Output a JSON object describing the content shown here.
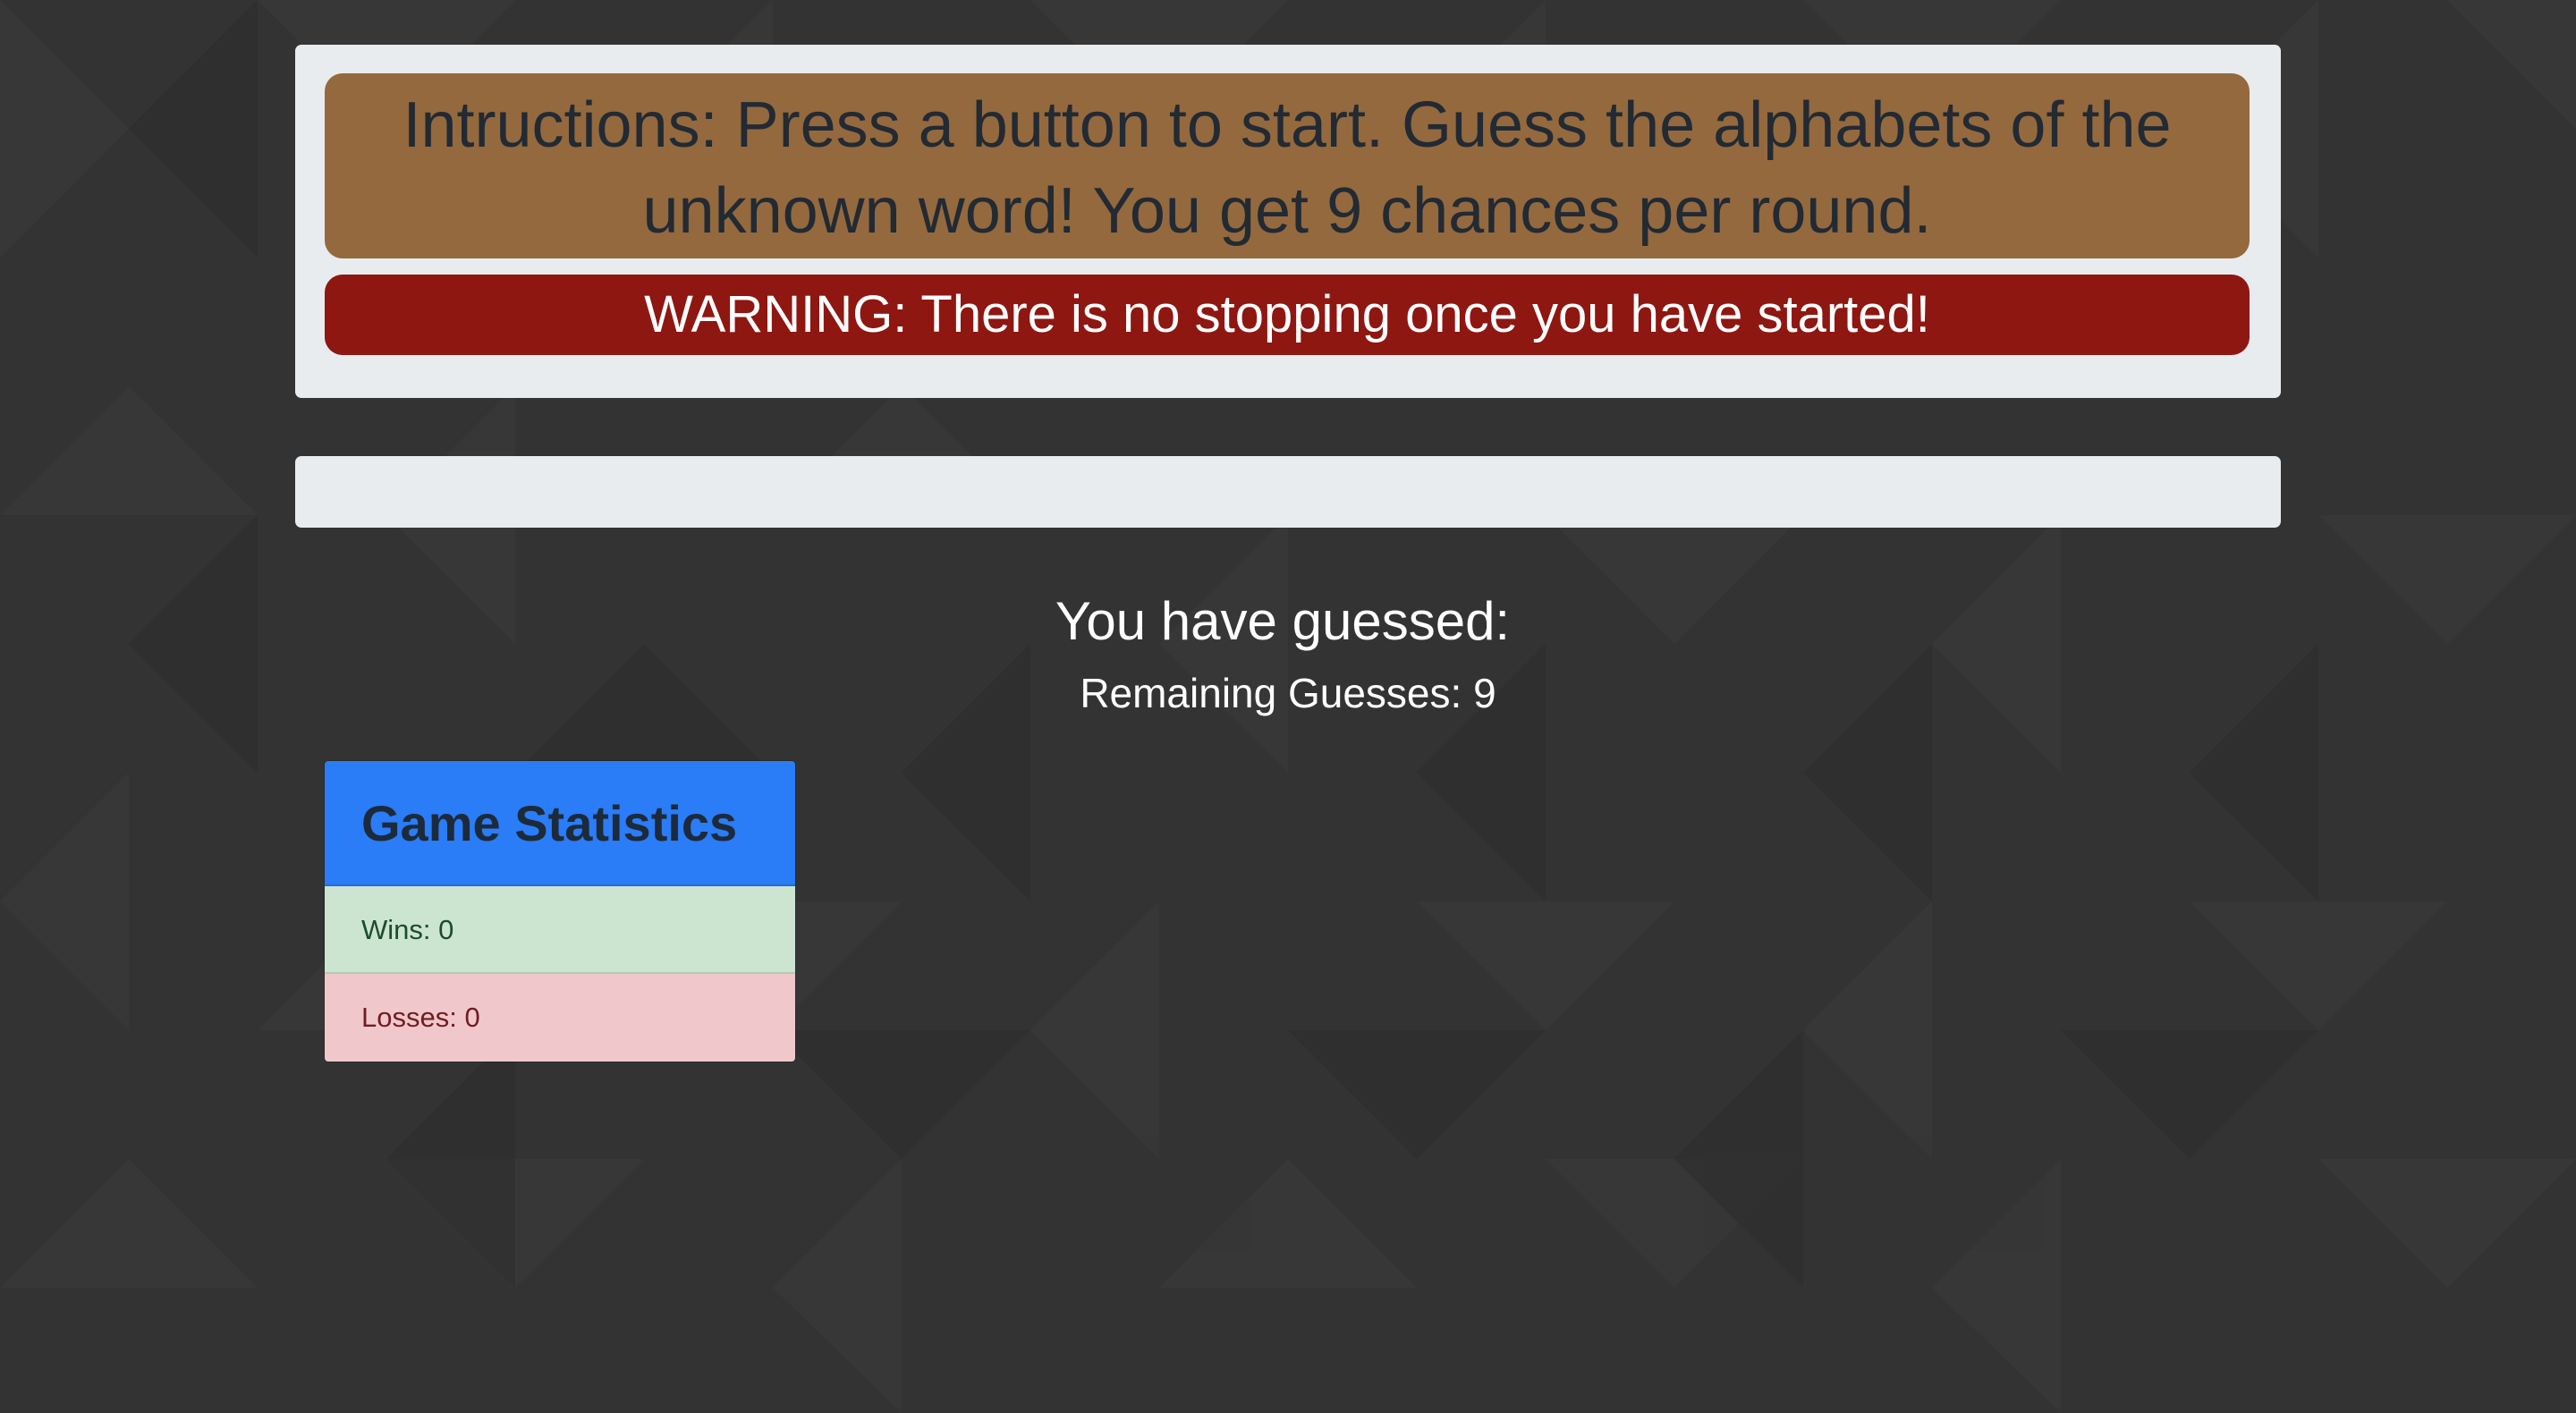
{
  "instructions": {
    "text": "Intructions: Press a button to start. Guess the alphabets of the unknown word! You get 9 chances per round.",
    "warning": "WARNING: There is no stopping once you have started!"
  },
  "word": {
    "display": ""
  },
  "guesses": {
    "title": "You have guessed:",
    "letters": "",
    "remaining_label": "Remaining Guesses: ",
    "remaining": "9"
  },
  "stats": {
    "title": "Game Statistics",
    "wins_label": "Wins: ",
    "wins": "0",
    "losses_label": "Losses: ",
    "losses": "0"
  },
  "colors": {
    "background": "#333333",
    "instructions_bg": "#94693e",
    "warning_bg": "#8e1712",
    "panel_bg": "#e9ecef",
    "stats_header": "#2a7cf7",
    "wins_bg": "#cce5d1",
    "losses_bg": "#f0c8cb"
  }
}
